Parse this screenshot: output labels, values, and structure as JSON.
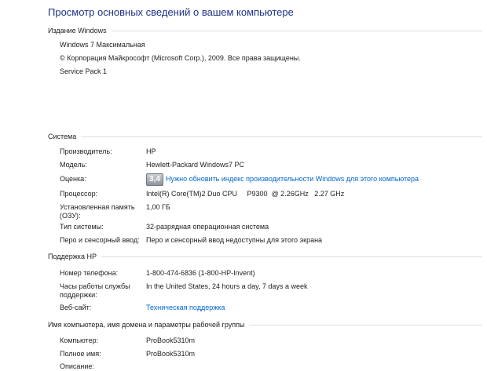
{
  "title": "Просмотр основных сведений о вашем компьютере",
  "windows_edition": {
    "header": "Издание Windows",
    "edition": "Windows 7 Максимальная",
    "copyright": "© Корпорация Майкрософт (Microsoft Corp.), 2009. Все права защищены.",
    "service_pack": "Service Pack 1"
  },
  "system": {
    "header": "Система",
    "manufacturer": {
      "label": "Производитель:",
      "value": "HP"
    },
    "model": {
      "label": "Модель:",
      "value": "Hewlett-Packard Windows7 PC"
    },
    "rating": {
      "label": "Оценка:",
      "score": "3,4",
      "link": "Нужно обновить индекс производительности Windows для этого компьютера"
    },
    "processor": {
      "label": "Процессор:",
      "value": "Intel(R) Core(TM)2 Duo CPU     P9300  @ 2.26GHz   2.27 GHz"
    },
    "memory": {
      "label": "Установленная память (ОЗУ):",
      "value": "1,00 ГБ"
    },
    "system_type": {
      "label": "Тип системы:",
      "value": "32-разрядная операционная система"
    },
    "pen_touch": {
      "label": "Перо и сенсорный ввод:",
      "value": "Перо и сенсорный ввод недоступны для этого экрана"
    }
  },
  "support": {
    "header": "Поддержка HP",
    "phone": {
      "label": "Номер телефона:",
      "value": "1-800-474-6836 (1-800-HP-Invent)"
    },
    "hours": {
      "label": "Часы работы службы поддержки:",
      "value": "In the United States, 24 hours a day, 7 days a week"
    },
    "website": {
      "label": "Веб-сайт:",
      "value": "Техническая поддержка"
    }
  },
  "computer_name": {
    "header": "Имя компьютера, имя домена и параметры рабочей группы",
    "computer": {
      "label": "Компьютер:",
      "value": "ProBook5310m"
    },
    "full_name": {
      "label": "Полное имя:",
      "value": "ProBook5310m"
    },
    "description": {
      "label": "Описание:",
      "value": ""
    }
  },
  "colors": {
    "title": "#1e3287",
    "link": "#0066cc",
    "rule": "#d5dfe5"
  }
}
